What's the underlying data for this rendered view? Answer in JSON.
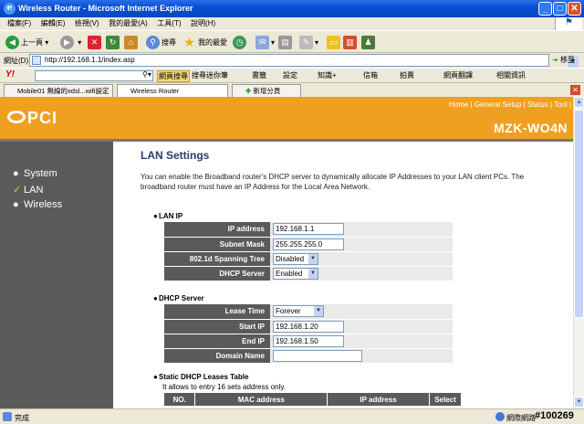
{
  "window": {
    "title": "Wireless Router - Microsoft Internet Explorer"
  },
  "menu": [
    "檔案(F)",
    "編輯(E)",
    "檢視(V)",
    "我的最愛(A)",
    "工具(T)",
    "說明(H)"
  ],
  "toolbar": {
    "back": "上一頁",
    "search": "搜尋",
    "favorites": "我的最愛"
  },
  "address": {
    "label": "網址(D)",
    "url": "http://192.168.1.1/index.asp",
    "go": "移至"
  },
  "yahoo": {
    "logo": "Y!",
    "items": [
      "網頁搜尋",
      "搜尋",
      "迷你筆",
      "書籤",
      "設定",
      "知識+",
      "信箱",
      "拍賣",
      "網頁翻譯",
      "相關資訊"
    ]
  },
  "tabs": [
    {
      "label": "Mobile01 無線的xdsl...wifi設定"
    },
    {
      "label": "Wireless Router"
    },
    {
      "label": "新增分頁"
    }
  ],
  "router": {
    "toplinks": "Home | General Setup | Status | Tool |",
    "logo": "PCI",
    "model": "MZK-WO4N",
    "nav": [
      {
        "bullet": "●",
        "label": "System"
      },
      {
        "bullet": "✓",
        "label": "LAN"
      },
      {
        "bullet": "●",
        "label": "Wireless"
      }
    ],
    "title": "LAN Settings",
    "description": "You can enable the Broadband router's DHCP server to dynamically allocate IP Addresses to your LAN client PCs. The broadband router must have an IP Address for the Local Area Network.",
    "lan_ip": {
      "heading": "LAN IP",
      "ip_label": "IP address",
      "ip_value": "192.168.1.1",
      "mask_label": "Subnet Mask",
      "mask_value": "255.255.255.0",
      "stp_label": "802.1d Spanning Tree",
      "stp_value": "Disabled",
      "dhcp_label": "DHCP Server",
      "dhcp_value": "Enabled"
    },
    "dhcp_server": {
      "heading": "DHCP Server",
      "lease_label": "Lease Time",
      "lease_value": "Forever",
      "start_label": "Start IP",
      "start_value": "192.168.1.20",
      "end_label": "End IP",
      "end_value": "192.168.1.50",
      "domain_label": "Domain Name",
      "domain_value": ""
    },
    "static_leases": {
      "heading": "Static DHCP Leases Table",
      "note": "It allows to entry 16 sets address only.",
      "columns": [
        "NO.",
        "MAC address",
        "IP address",
        "Select"
      ]
    }
  },
  "status": {
    "text": "完成",
    "zone": "網際網路",
    "watermark": "#100269"
  }
}
